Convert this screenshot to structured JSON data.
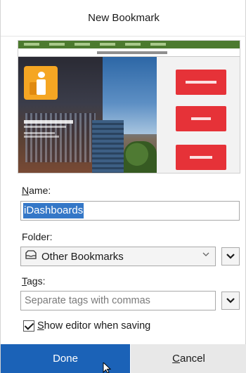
{
  "dialog": {
    "title": "New Bookmark"
  },
  "fields": {
    "name_label_access": "N",
    "name_label_rest": "ame:",
    "name_value": "iDashboards",
    "folder_label": "Folder:",
    "folder_value": "Other Bookmarks",
    "tags_label_access": "T",
    "tags_label_rest": "ags:",
    "tags_placeholder": "Separate tags with commas",
    "show_editor_label_access": "S",
    "show_editor_label_rest": "how editor when saving",
    "show_editor_checked": true
  },
  "buttons": {
    "done": "Done",
    "cancel_access": "C",
    "cancel_rest": "ancel"
  },
  "icons": {
    "folder": "bookmarks-folder-icon",
    "select_chevron": "chevron-down-icon",
    "expander": "chevron-down-icon"
  },
  "colors": {
    "primary_button": "#1b62b7",
    "selection": "#3477c7",
    "thumbnail_brand": "#f5a623",
    "thumbnail_buttons": "#e63238"
  }
}
